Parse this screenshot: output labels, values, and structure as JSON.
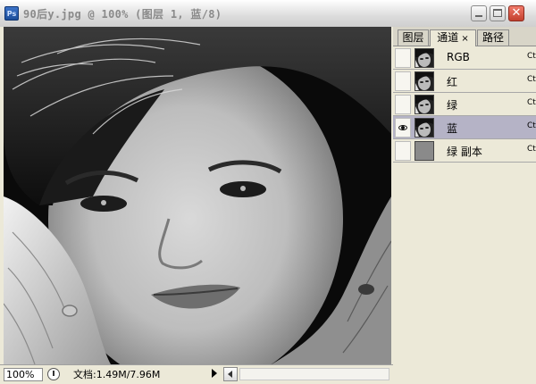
{
  "window": {
    "app_icon_label": "Ps",
    "title": "90后y.jpg @ 100% (图层 1, 蓝/8)"
  },
  "status": {
    "zoom": "100%",
    "doc_info": "文档:1.49M/7.96M"
  },
  "panel": {
    "tabs": [
      {
        "label": "图层",
        "active": false
      },
      {
        "label": "通道",
        "active": true,
        "close": "×"
      },
      {
        "label": "路径",
        "active": false
      }
    ],
    "channels": [
      {
        "label": "RGB",
        "shortcut": "Ct",
        "visible": false,
        "selected": false,
        "thumb": "photo"
      },
      {
        "label": "红",
        "shortcut": "Ct",
        "visible": false,
        "selected": false,
        "thumb": "photo"
      },
      {
        "label": "绿",
        "shortcut": "Ct",
        "visible": false,
        "selected": false,
        "thumb": "photo"
      },
      {
        "label": "蓝",
        "shortcut": "Ct",
        "visible": true,
        "selected": true,
        "thumb": "photo"
      },
      {
        "label": "绿 副本",
        "shortcut": "Ct",
        "visible": false,
        "selected": false,
        "thumb": "gray"
      }
    ]
  },
  "colors": {
    "selected_row": "#b5b3c6",
    "close_button": "#c3402e"
  }
}
